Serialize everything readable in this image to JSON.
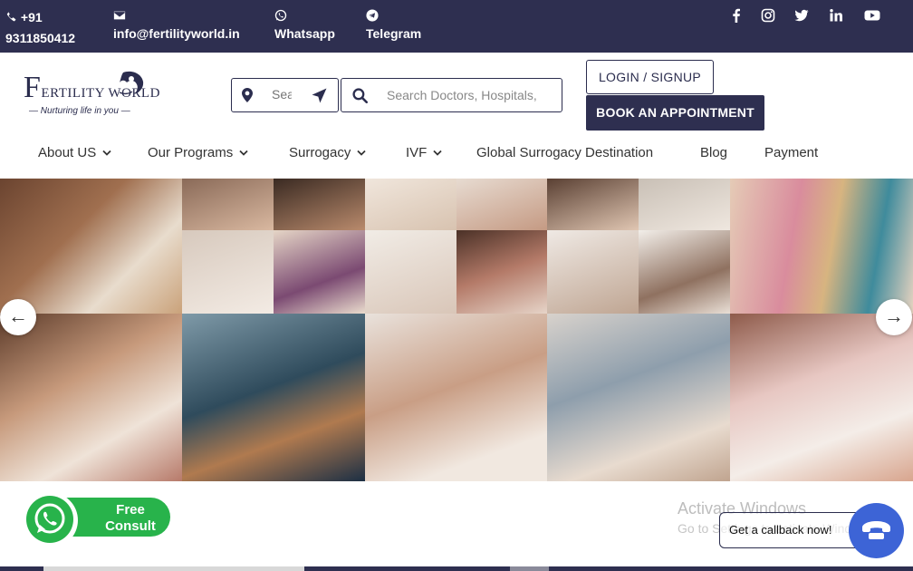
{
  "colors": {
    "brand_dark": "#2e2f50",
    "whatsapp_green": "#28b34b",
    "callback_blue": "#3d64d6"
  },
  "topbar": {
    "phone_prefix": "+91",
    "phone_number": "9311850412",
    "email": "info@fertilityworld.in",
    "whatsapp": "Whatsapp",
    "telegram": "Telegram",
    "social_icons": [
      "facebook-icon",
      "instagram-icon",
      "twitter-icon",
      "linkedin-icon",
      "youtube-icon"
    ]
  },
  "logo": {
    "name_first_letter": "F",
    "name_rest": "ERTILITY WORLD",
    "tagline": "Nurturing life in you"
  },
  "search": {
    "location_placeholder": "Sea",
    "main_placeholder": "Search Doctors, Hospitals,"
  },
  "buttons": {
    "login": "LOGIN / SIGNUP",
    "book": "BOOK AN APPOINTMENT"
  },
  "nav": [
    {
      "label": "About US",
      "dropdown": true
    },
    {
      "label": "Our Programs",
      "dropdown": true
    },
    {
      "label": "Surrogacy",
      "dropdown": true
    },
    {
      "label": "IVF",
      "dropdown": true
    },
    {
      "label": "Global Surrogacy Destination",
      "dropdown": false
    },
    {
      "label": "Blog",
      "dropdown": false
    },
    {
      "label": "Payment",
      "dropdown": false
    }
  ],
  "carousel": {
    "prev_arrow": "←",
    "next_arrow": "→"
  },
  "whatsapp_widget": {
    "line1": "Free",
    "line2": "Consult"
  },
  "windows_watermark": {
    "title": "Activate Windows",
    "subtitle": "Go to Settings to activate Windows."
  },
  "callback": {
    "label": "Get a callback now!"
  }
}
